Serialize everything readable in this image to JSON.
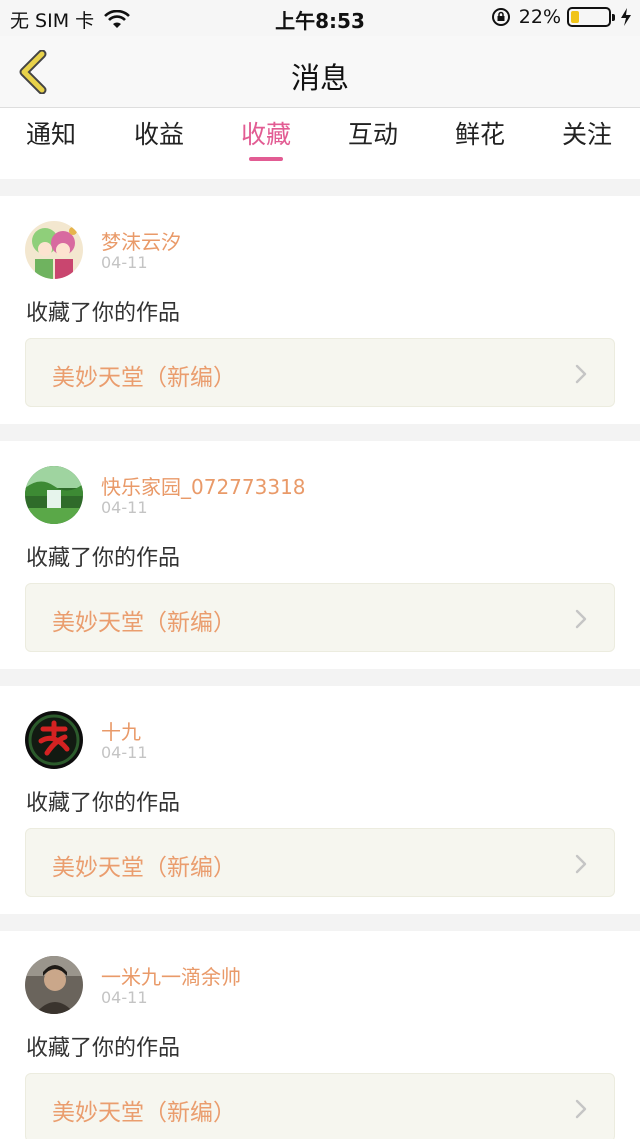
{
  "status_bar": {
    "carrier": "无 SIM 卡",
    "time": "上午8:53",
    "battery_percent": "22%",
    "battery_level": 0.22
  },
  "nav": {
    "title": "消息",
    "back_icon": "chevron-left-icon"
  },
  "tabs": [
    {
      "label": "通知",
      "active": false
    },
    {
      "label": "收益",
      "active": false
    },
    {
      "label": "收藏",
      "active": true
    },
    {
      "label": "互动",
      "active": false
    },
    {
      "label": "鲜花",
      "active": false
    },
    {
      "label": "关注",
      "active": false
    }
  ],
  "colors": {
    "accent": "#e25c93",
    "username": "#e99a69",
    "work_title": "#ea9d6e",
    "battery": "#f0c419",
    "back_arrow": "#e8d24a"
  },
  "messages": [
    {
      "user": "梦沫云汐",
      "date": "04-11",
      "action": "收藏了你的作品",
      "work": "美妙天堂（新编）"
    },
    {
      "user": "快乐家园_072773318",
      "date": "04-11",
      "action": "收藏了你的作品",
      "work": "美妙天堂（新编）"
    },
    {
      "user": "十九",
      "date": "04-11",
      "action": "收藏了你的作品",
      "work": "美妙天堂（新编）"
    },
    {
      "user": "一米九一滴余帅",
      "date": "04-11",
      "action": "收藏了你的作品",
      "work": "美妙天堂（新编）"
    }
  ]
}
